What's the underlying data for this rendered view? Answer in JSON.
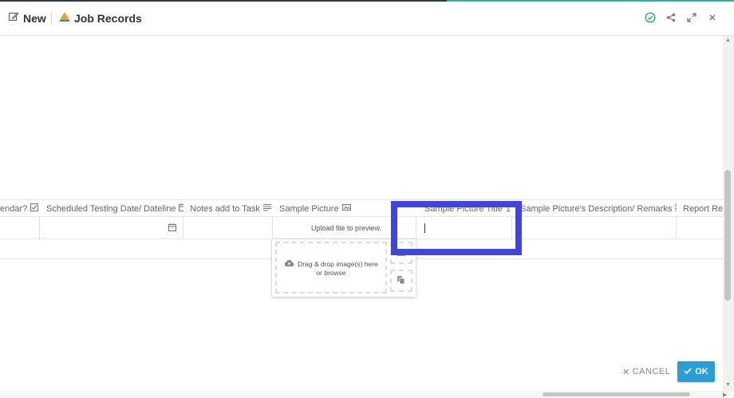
{
  "header": {
    "new_label": "New",
    "title": "Job Records"
  },
  "columns": [
    {
      "label": "endar?",
      "icon": "checkbox-icon"
    },
    {
      "label": "Scheduled Testing Date/ Dateline",
      "icon": "calendar-icon"
    },
    {
      "label": "Notes add to Task",
      "icon": "text-lines-icon"
    },
    {
      "label": "Sample Picture",
      "icon": "image-icon"
    },
    {
      "label": "Sample Picture Title",
      "icon": "text-cursor-icon"
    },
    {
      "label": "Sample Picture's Description/ Remarks",
      "icon": "text-lines-icon"
    },
    {
      "label": "Report Rem",
      "icon": ""
    }
  ],
  "row": {
    "upload_hint": "Upload file to preview."
  },
  "upload_popup": {
    "dropzone_text_1": "Drag & drop image(s) here",
    "dropzone_text_2": "or browse"
  },
  "footer": {
    "cancel_label": "CANCEL",
    "ok_label": "OK"
  },
  "colors": {
    "highlight": "#4046d9",
    "ok_button": "#2a9fd6",
    "status_green": "#2bb24c"
  }
}
